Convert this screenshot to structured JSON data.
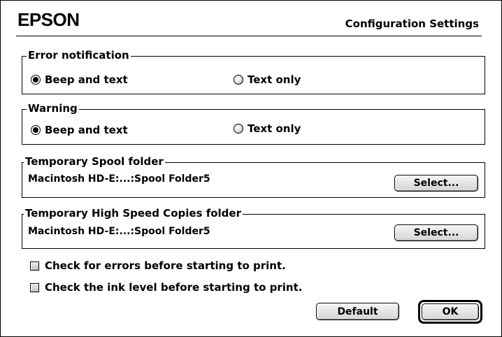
{
  "header": {
    "brand": "EPSON",
    "title": "Configuration Settings"
  },
  "error_notification": {
    "label": "Error notification",
    "options": [
      {
        "label": "Beep and text",
        "selected": true
      },
      {
        "label": "Text only",
        "selected": false
      }
    ]
  },
  "warning": {
    "label": "Warning",
    "options": [
      {
        "label": "Beep and text",
        "selected": true
      },
      {
        "label": "Text only",
        "selected": false
      }
    ]
  },
  "spool_folder": {
    "label": "Temporary Spool folder",
    "path": "Macintosh HD-E:...:Spool Folder5",
    "button": "Select..."
  },
  "high_speed_folder": {
    "label": "Temporary High Speed Copies folder",
    "path": "Macintosh HD-E:...:Spool Folder5",
    "button": "Select..."
  },
  "checks": [
    {
      "label": "Check for errors before starting to print.",
      "checked": false
    },
    {
      "label": "Check the ink level before starting to print.",
      "checked": false
    }
  ],
  "buttons": {
    "default": "Default",
    "ok": "OK"
  }
}
